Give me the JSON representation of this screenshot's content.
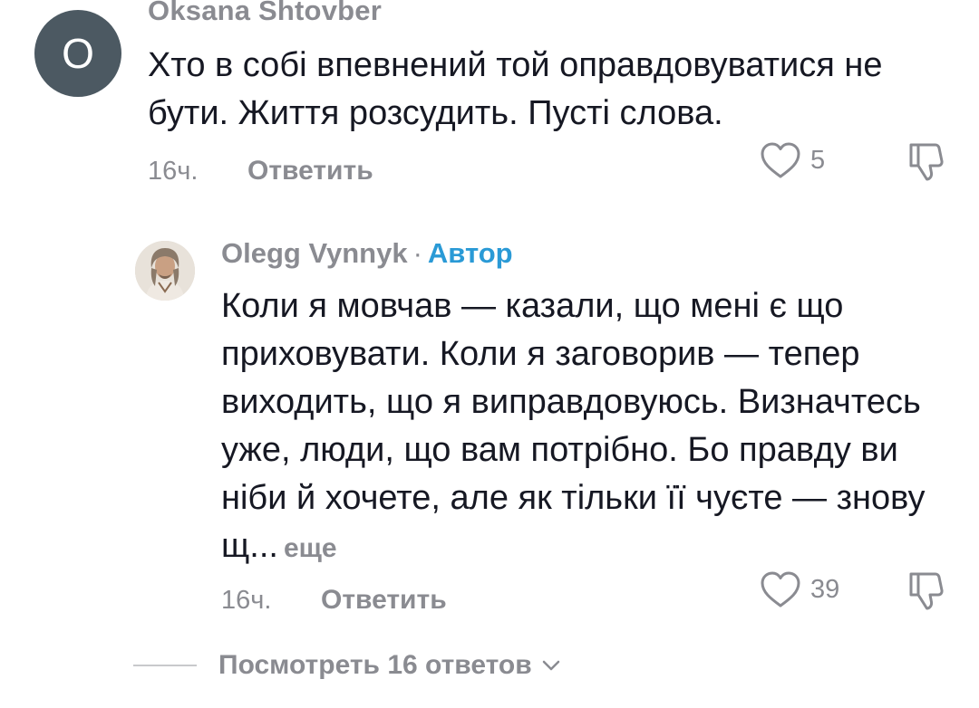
{
  "comments": [
    {
      "avatar_letter": "O",
      "avatar_color": "#4c5962",
      "username": "Oksana Shtovber",
      "text": "Хто в собі впевнений той оправдовуватися не бути. Життя розсудить. Пусті слова.",
      "time": "16ч.",
      "reply_label": "Ответить",
      "like_count": "5",
      "like_icon": "heart-outline-icon",
      "dislike_icon": "thumbs-down-icon"
    },
    {
      "username": "Olegg Vynnyk",
      "separator": "·",
      "author_badge": "Автор",
      "author_badge_color": "#2a9ad6",
      "text": "Коли я мовчав — казали, що мені є що приховувати. Коли я заговорив — тепер виходить, що я виправдовуюсь. Визначтесь уже, люди, що вам потрібно. Бо правду ви ніби й хочете, але як тільки її чуєте — знову щ...",
      "more_label": "еще",
      "time": "16ч.",
      "reply_label": "Ответить",
      "like_count": "39",
      "like_icon": "heart-outline-icon",
      "dislike_icon": "thumbs-down-icon"
    }
  ],
  "view_replies": {
    "label": "Посмотреть 16 ответов",
    "icon": "chevron-down-icon"
  }
}
